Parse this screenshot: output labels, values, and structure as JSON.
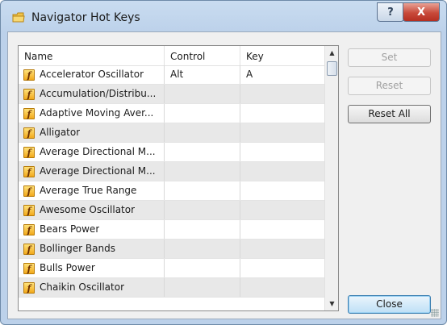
{
  "window": {
    "title": "Navigator Hot Keys"
  },
  "titlebar_buttons": {
    "help": "?",
    "close": "X"
  },
  "table": {
    "columns": [
      "Name",
      "Control",
      "Key"
    ],
    "rows": [
      {
        "name": "Accelerator Oscillator",
        "control": "Alt",
        "key": "A"
      },
      {
        "name": "Accumulation/Distribu...",
        "control": "",
        "key": ""
      },
      {
        "name": "Adaptive Moving Aver...",
        "control": "",
        "key": ""
      },
      {
        "name": "Alligator",
        "control": "",
        "key": ""
      },
      {
        "name": "Average Directional M...",
        "control": "",
        "key": ""
      },
      {
        "name": "Average Directional M...",
        "control": "",
        "key": ""
      },
      {
        "name": "Average True Range",
        "control": "",
        "key": ""
      },
      {
        "name": "Awesome Oscillator",
        "control": "",
        "key": ""
      },
      {
        "name": "Bears Power",
        "control": "",
        "key": ""
      },
      {
        "name": "Bollinger Bands",
        "control": "",
        "key": ""
      },
      {
        "name": "Bulls Power",
        "control": "",
        "key": ""
      },
      {
        "name": "Chaikin Oscillator",
        "control": "",
        "key": ""
      }
    ],
    "row_icon": "function-icon",
    "row_icon_glyph": "f"
  },
  "buttons": {
    "set": "Set",
    "reset": "Reset",
    "reset_all": "Reset All",
    "close": "Close"
  },
  "scrollbar": {
    "up_glyph": "▲",
    "down_glyph": "▼"
  },
  "colors": {
    "accent": "#3c7fb1",
    "icon": "#f2a91b"
  }
}
